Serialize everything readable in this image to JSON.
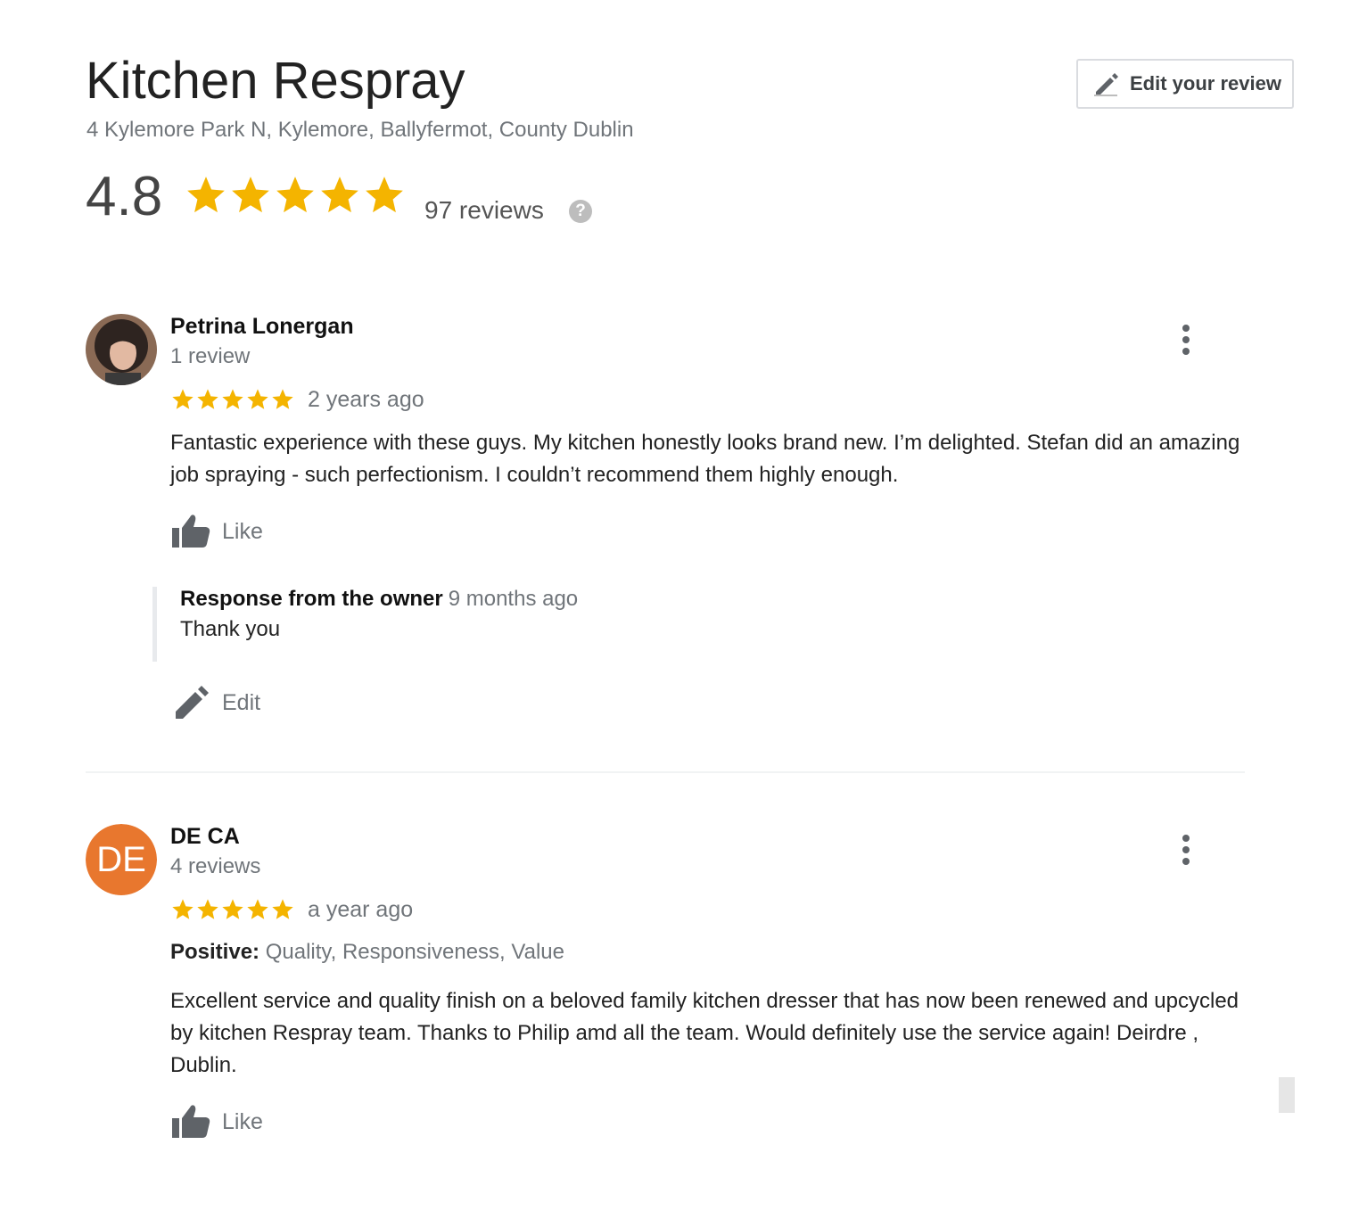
{
  "business": {
    "name": "Kitchen Respray",
    "address": "4 Kylemore Park N, Kylemore, Ballyfermot, County Dublin",
    "rating": "4.8",
    "rating_value": 4.8,
    "reviews_count": "97 reviews",
    "help_symbol": "?"
  },
  "header": {
    "edit_review_label": "Edit your review"
  },
  "colors": {
    "star": "#f4b400",
    "avatar_de": "#e8772e",
    "muted_text": "#70757a"
  },
  "reviews": [
    {
      "name": "Petrina Lonergan",
      "count": "1 review",
      "stars": 5,
      "date": "2 years ago",
      "text": "Fantastic experience with these guys. My kitchen honestly looks brand new. I’m delighted. Stefan did an amazing job spraying - such perfectionism. I couldn’t recommend them highly enough.",
      "like_label": "Like",
      "owner_response": {
        "label": "Response from the owner",
        "date": "9 months ago",
        "text": "Thank you",
        "edit_label": "Edit"
      }
    },
    {
      "name": "DE CA",
      "avatar_initials": "DE",
      "count": "4 reviews",
      "stars": 5,
      "date": "a year ago",
      "positive_label": "Positive:",
      "positive_values": "Quality, Responsiveness, Value",
      "text": "Excellent service and quality finish on a beloved family kitchen dresser that has now been renewed and upcycled by kitchen Respray team. Thanks to Philip amd all the team. Would definitely use the service again! Deirdre , Dublin.",
      "like_label": "Like"
    }
  ]
}
